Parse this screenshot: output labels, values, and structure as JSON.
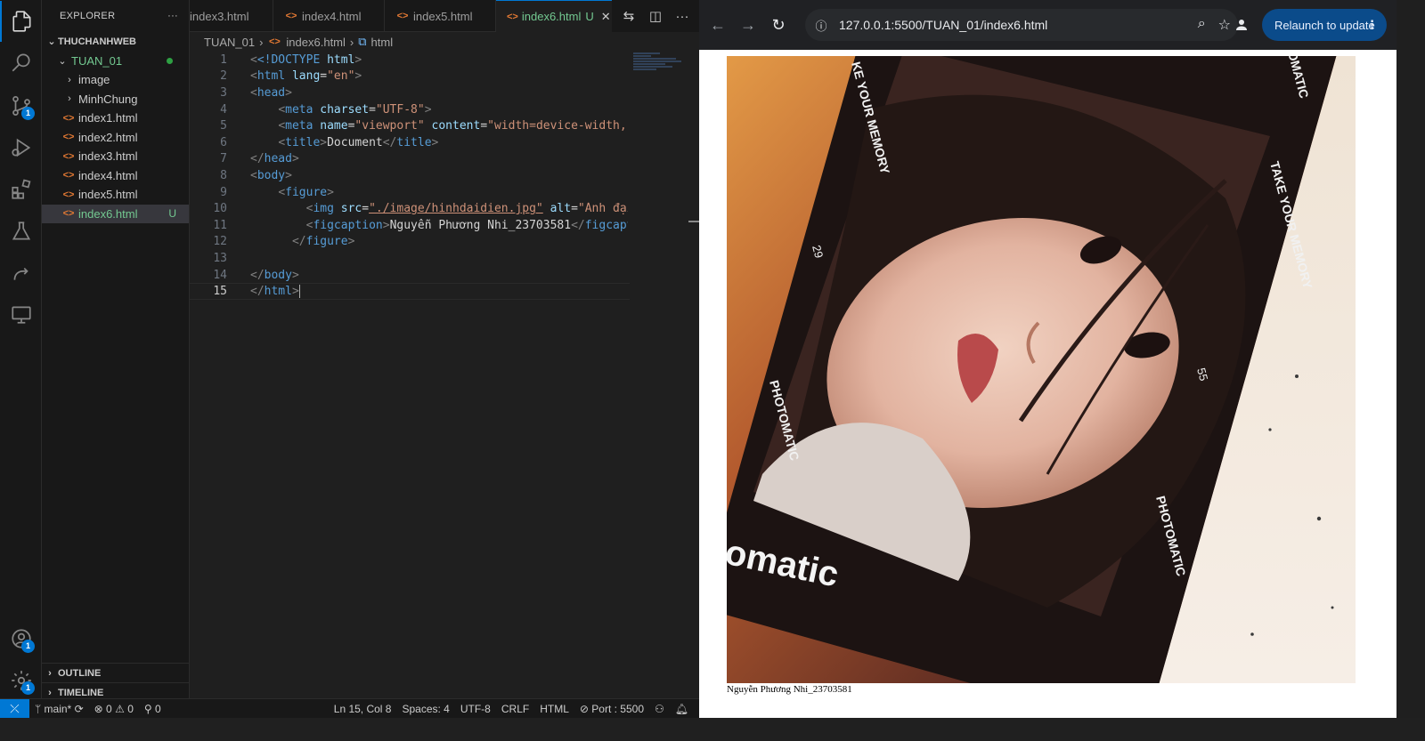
{
  "explorer": {
    "title": "EXPLORER",
    "more": "···",
    "workspace": "THUCHANHWEB",
    "folder": "TUAN_01",
    "items": [
      {
        "label": "image",
        "type": "folder"
      },
      {
        "label": "MinhChung",
        "type": "folder"
      },
      {
        "label": "index1.html",
        "type": "html"
      },
      {
        "label": "index2.html",
        "type": "html"
      },
      {
        "label": "index3.html",
        "type": "html"
      },
      {
        "label": "index4.html",
        "type": "html"
      },
      {
        "label": "index5.html",
        "type": "html"
      },
      {
        "label": "index6.html",
        "type": "html",
        "status": "U"
      }
    ],
    "outline": "OUTLINE",
    "timeline": "TIMELINE"
  },
  "activity_badges": {
    "scm": "1",
    "accounts": "1",
    "settings": "1"
  },
  "tabs": [
    {
      "label": "index3.html"
    },
    {
      "label": "index4.html"
    },
    {
      "label": "index5.html"
    },
    {
      "label": "index6.html",
      "status": "U",
      "active": true
    }
  ],
  "breadcrumb": {
    "folder": "TUAN_01",
    "file": "index6.html",
    "symbol": "html"
  },
  "code": {
    "line_numbers": [
      "1",
      "2",
      "3",
      "4",
      "5",
      "6",
      "7",
      "8",
      "9",
      "10",
      "11",
      "12",
      "13",
      "14",
      "15"
    ],
    "doctype": "<!DOCTYPE",
    "doctype_html": "html",
    "lang_val": "\"en\"",
    "charset_val": "\"UTF-8\"",
    "viewport_val": "\"viewport\"",
    "content_val": "\"width=device-width, in",
    "title_text": "Document",
    "img_src": "\"./image/hinhdaidien.jpg\"",
    "img_alt": "\"Ảnh đại c",
    "figcaption_text": "Nguyễn Phương Nhi_23703581"
  },
  "statusbar": {
    "branch": "main*",
    "errors": "0",
    "warnings": "0",
    "ports": "0",
    "position": "Ln 15, Col 8",
    "spaces": "Spaces: 4",
    "encoding": "UTF-8",
    "eol": "CRLF",
    "language": "HTML",
    "port": "Port : 5500"
  },
  "browser": {
    "url": "127.0.0.1:5500/TUAN_01/index6.html",
    "relaunch": "Relaunch to update",
    "caption": "Nguyễn Phương Nhi_23703581",
    "photo_texts": {
      "take_memory_1": "KE YOUR MEMORY",
      "take_memory_2": "TAKE YOUR MEMORY",
      "num_29": "29",
      "num_55": "55",
      "photomatic_1": "PHOTOMATIC",
      "photomatic_2": "PHOTOMATIC",
      "omatic_top": "OMATIC",
      "omatic_big": "omatic"
    }
  }
}
